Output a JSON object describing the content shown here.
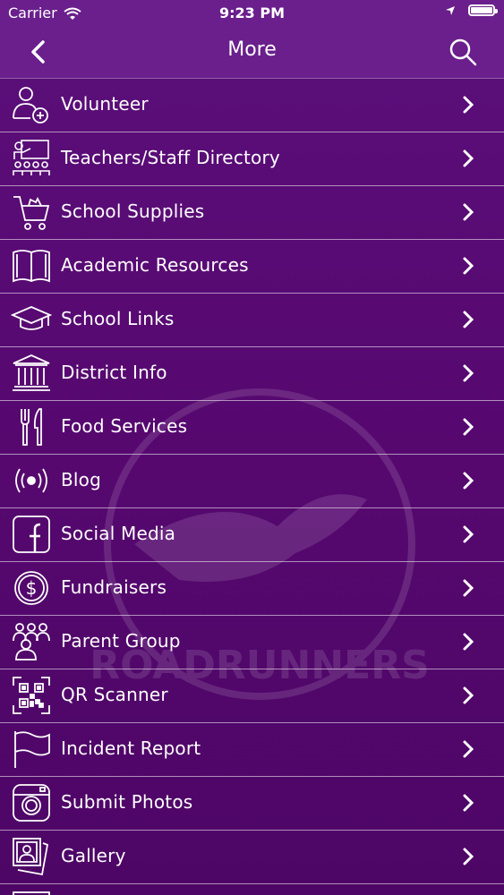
{
  "status_bar": {
    "carrier": "Carrier",
    "time": "9:23 PM"
  },
  "nav": {
    "title": "More"
  },
  "watermark_text": "ROADRUNNERS",
  "menu": {
    "items": [
      {
        "label": "Volunteer",
        "icon": "volunteer-icon"
      },
      {
        "label": "Teachers/Staff Directory",
        "icon": "teacher-directory-icon"
      },
      {
        "label": "School Supplies",
        "icon": "shopping-cart-icon"
      },
      {
        "label": "Academic Resources",
        "icon": "book-icon"
      },
      {
        "label": "School Links",
        "icon": "graduation-cap-icon"
      },
      {
        "label": "District Info",
        "icon": "building-icon"
      },
      {
        "label": "Food Services",
        "icon": "fork-knife-icon"
      },
      {
        "label": "Blog",
        "icon": "broadcast-icon"
      },
      {
        "label": "Social Media",
        "icon": "facebook-icon"
      },
      {
        "label": "Fundraisers",
        "icon": "dollar-coin-icon"
      },
      {
        "label": "Parent Group",
        "icon": "group-icon"
      },
      {
        "label": "QR Scanner",
        "icon": "qr-code-icon"
      },
      {
        "label": "Incident Report",
        "icon": "flag-icon"
      },
      {
        "label": "Submit Photos",
        "icon": "camera-icon"
      },
      {
        "label": "Gallery",
        "icon": "photos-icon"
      }
    ]
  }
}
